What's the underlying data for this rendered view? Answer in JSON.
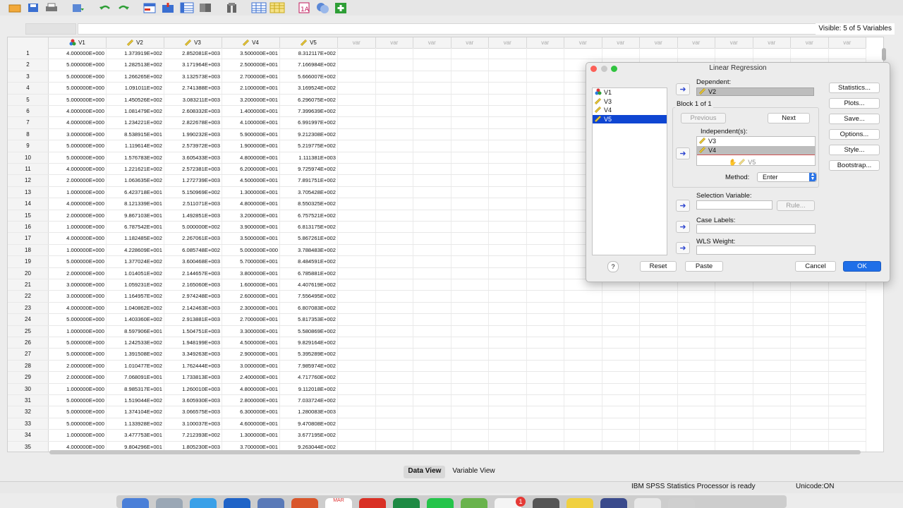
{
  "toolbar": {
    "icons": [
      "open-file-icon",
      "save-icon",
      "print-icon",
      "recall-dialog-icon",
      "undo-icon",
      "redo-icon",
      "goto-case-icon",
      "goto-variable-icon",
      "variables-icon",
      "find-icon",
      "split-file-icon",
      "weight-cases-icon",
      "select-cases-icon",
      "value-labels-icon",
      "use-sets-icon",
      "spelling-icon"
    ]
  },
  "filter": {
    "visible_text": "Visible: 5 of 5 Variables"
  },
  "grid": {
    "variables": [
      {
        "name": "V1",
        "icon": "nominal-icon"
      },
      {
        "name": "V2",
        "icon": "scale-icon"
      },
      {
        "name": "V3",
        "icon": "scale-icon"
      },
      {
        "name": "V4",
        "icon": "scale-icon"
      },
      {
        "name": "V5",
        "icon": "scale-icon"
      }
    ],
    "empty_header": "var",
    "empty_columns": 14,
    "rows": [
      [
        "1",
        "4.000000E+000",
        "1.373919E+002",
        "2.852081E+003",
        "3.500000E+001",
        "8.312117E+002"
      ],
      [
        "2",
        "5.000000E+000",
        "1.282513E+002",
        "3.171964E+003",
        "2.500000E+001",
        "7.166984E+002"
      ],
      [
        "3",
        "5.000000E+000",
        "1.266265E+002",
        "3.132573E+003",
        "2.700000E+001",
        "5.666007E+002"
      ],
      [
        "4",
        "5.000000E+000",
        "1.091011E+002",
        "2.741388E+003",
        "2.100000E+001",
        "3.169524E+002"
      ],
      [
        "5",
        "5.000000E+000",
        "1.450526E+002",
        "3.083211E+003",
        "3.200000E+001",
        "6.296075E+002"
      ],
      [
        "6",
        "4.000000E+000",
        "1.081479E+002",
        "2.608332E+003",
        "1.400000E+001",
        "7.399639E+002"
      ],
      [
        "7",
        "4.000000E+000",
        "1.234221E+002",
        "2.822678E+003",
        "4.100000E+001",
        "6.991997E+002"
      ],
      [
        "8",
        "3.000000E+000",
        "8.538915E+001",
        "1.990232E+003",
        "5.900000E+001",
        "9.212308E+002"
      ],
      [
        "9",
        "5.000000E+000",
        "1.119614E+002",
        "2.573972E+003",
        "1.900000E+001",
        "5.219775E+002"
      ],
      [
        "10",
        "5.000000E+000",
        "1.576783E+002",
        "3.605433E+003",
        "4.800000E+001",
        "1.111381E+003"
      ],
      [
        "11",
        "4.000000E+000",
        "1.221621E+002",
        "2.572381E+003",
        "6.200000E+001",
        "9.725974E+002"
      ],
      [
        "12",
        "2.000000E+000",
        "1.063635E+002",
        "1.272739E+003",
        "4.500000E+001",
        "7.891751E+002"
      ],
      [
        "13",
        "1.000000E+000",
        "6.423718E+001",
        "5.150969E+002",
        "1.300000E+001",
        "3.705428E+002"
      ],
      [
        "14",
        "4.000000E+000",
        "8.121339E+001",
        "2.511071E+003",
        "4.800000E+001",
        "8.550325E+002"
      ],
      [
        "15",
        "2.000000E+000",
        "9.867103E+001",
        "1.492851E+003",
        "3.200000E+001",
        "6.757521E+002"
      ],
      [
        "16",
        "1.000000E+000",
        "6.787542E+001",
        "5.000000E+002",
        "3.900000E+001",
        "6.813175E+002"
      ],
      [
        "17",
        "4.000000E+000",
        "1.182485E+002",
        "2.267061E+003",
        "3.500000E+001",
        "5.867261E+002"
      ],
      [
        "18",
        "1.000000E+000",
        "4.228609E+001",
        "6.085748E+002",
        "5.000000E+000",
        "3.788483E+002"
      ],
      [
        "19",
        "5.000000E+000",
        "1.377024E+002",
        "3.600468E+003",
        "5.700000E+001",
        "8.484591E+002"
      ],
      [
        "20",
        "2.000000E+000",
        "1.014051E+002",
        "2.144657E+003",
        "3.800000E+001",
        "6.785881E+002"
      ],
      [
        "21",
        "3.000000E+000",
        "1.059231E+002",
        "2.165060E+003",
        "1.600000E+001",
        "4.407619E+002"
      ],
      [
        "22",
        "3.000000E+000",
        "1.164957E+002",
        "2.974248E+003",
        "2.600000E+001",
        "7.556495E+002"
      ],
      [
        "23",
        "4.000000E+000",
        "1.040862E+002",
        "2.142463E+003",
        "2.300000E+001",
        "6.807083E+002"
      ],
      [
        "24",
        "5.000000E+000",
        "1.403360E+002",
        "2.913881E+003",
        "2.700000E+001",
        "5.817353E+002"
      ],
      [
        "25",
        "1.000000E+000",
        "8.597906E+001",
        "1.504751E+003",
        "3.300000E+001",
        "5.580869E+002"
      ],
      [
        "26",
        "5.000000E+000",
        "1.242533E+002",
        "1.948199E+003",
        "4.500000E+001",
        "9.829164E+002"
      ],
      [
        "27",
        "5.000000E+000",
        "1.391508E+002",
        "3.349263E+003",
        "2.900000E+001",
        "5.395289E+002"
      ],
      [
        "28",
        "2.000000E+000",
        "1.010477E+002",
        "1.762444E+003",
        "3.000000E+001",
        "7.985974E+002"
      ],
      [
        "29",
        "2.000000E+000",
        "7.068091E+001",
        "1.733813E+003",
        "2.400000E+001",
        "4.717760E+002"
      ],
      [
        "30",
        "1.000000E+000",
        "8.985317E+001",
        "1.260010E+003",
        "4.800000E+001",
        "9.112018E+002"
      ],
      [
        "31",
        "5.000000E+000",
        "1.519044E+002",
        "3.605930E+003",
        "2.800000E+001",
        "7.033724E+002"
      ],
      [
        "32",
        "5.000000E+000",
        "1.374104E+002",
        "3.066575E+003",
        "6.300000E+001",
        "1.280083E+003"
      ],
      [
        "33",
        "5.000000E+000",
        "1.133928E+002",
        "3.100037E+003",
        "4.600000E+001",
        "9.470808E+002"
      ],
      [
        "34",
        "1.000000E+000",
        "3.477753E+001",
        "7.212393E+002",
        "1.300000E+001",
        "3.677195E+002"
      ],
      [
        "35",
        "4.000000E+000",
        "9.804296E+001",
        "1.805230E+003",
        "3.700000E+001",
        "9.263044E+002"
      ]
    ]
  },
  "tabs": {
    "data_view": "Data View",
    "variable_view": "Variable View"
  },
  "status": {
    "message": "IBM SPSS Statistics Processor is ready",
    "unicode": "Unicode:ON"
  },
  "dock": {
    "badge_count": "1",
    "calendar_label": "MAR"
  },
  "dialog": {
    "title": "Linear Regression",
    "source_vars": [
      {
        "name": "V1",
        "icon": "nominal-icon",
        "selected": false
      },
      {
        "name": "V3",
        "icon": "scale-icon",
        "selected": false
      },
      {
        "name": "V4",
        "icon": "scale-icon",
        "selected": false
      },
      {
        "name": "V5",
        "icon": "scale-icon",
        "selected": true
      }
    ],
    "dependent_label": "Dependent:",
    "dependent_value": "V2",
    "block_label": "Block 1 of 1",
    "previous_label": "Previous",
    "next_label": "Next",
    "independents_label": "Independent(s):",
    "independents": [
      "V3",
      "V4"
    ],
    "dragging_value": "V5",
    "method_label": "Method:",
    "method_value": "Enter",
    "selection_label": "Selection Variable:",
    "rule_label": "Rule...",
    "case_labels_label": "Case Labels:",
    "wls_label": "WLS Weight:",
    "side_buttons": [
      "Statistics...",
      "Plots...",
      "Save...",
      "Options...",
      "Style...",
      "Bootstrap..."
    ],
    "help_label": "?",
    "reset_label": "Reset",
    "paste_label": "Paste",
    "cancel_label": "Cancel",
    "ok_label": "OK"
  },
  "colors": {
    "selection": "#0f46d2",
    "ok_button": "#1f6fe8",
    "arrow": "#2f47d0"
  }
}
